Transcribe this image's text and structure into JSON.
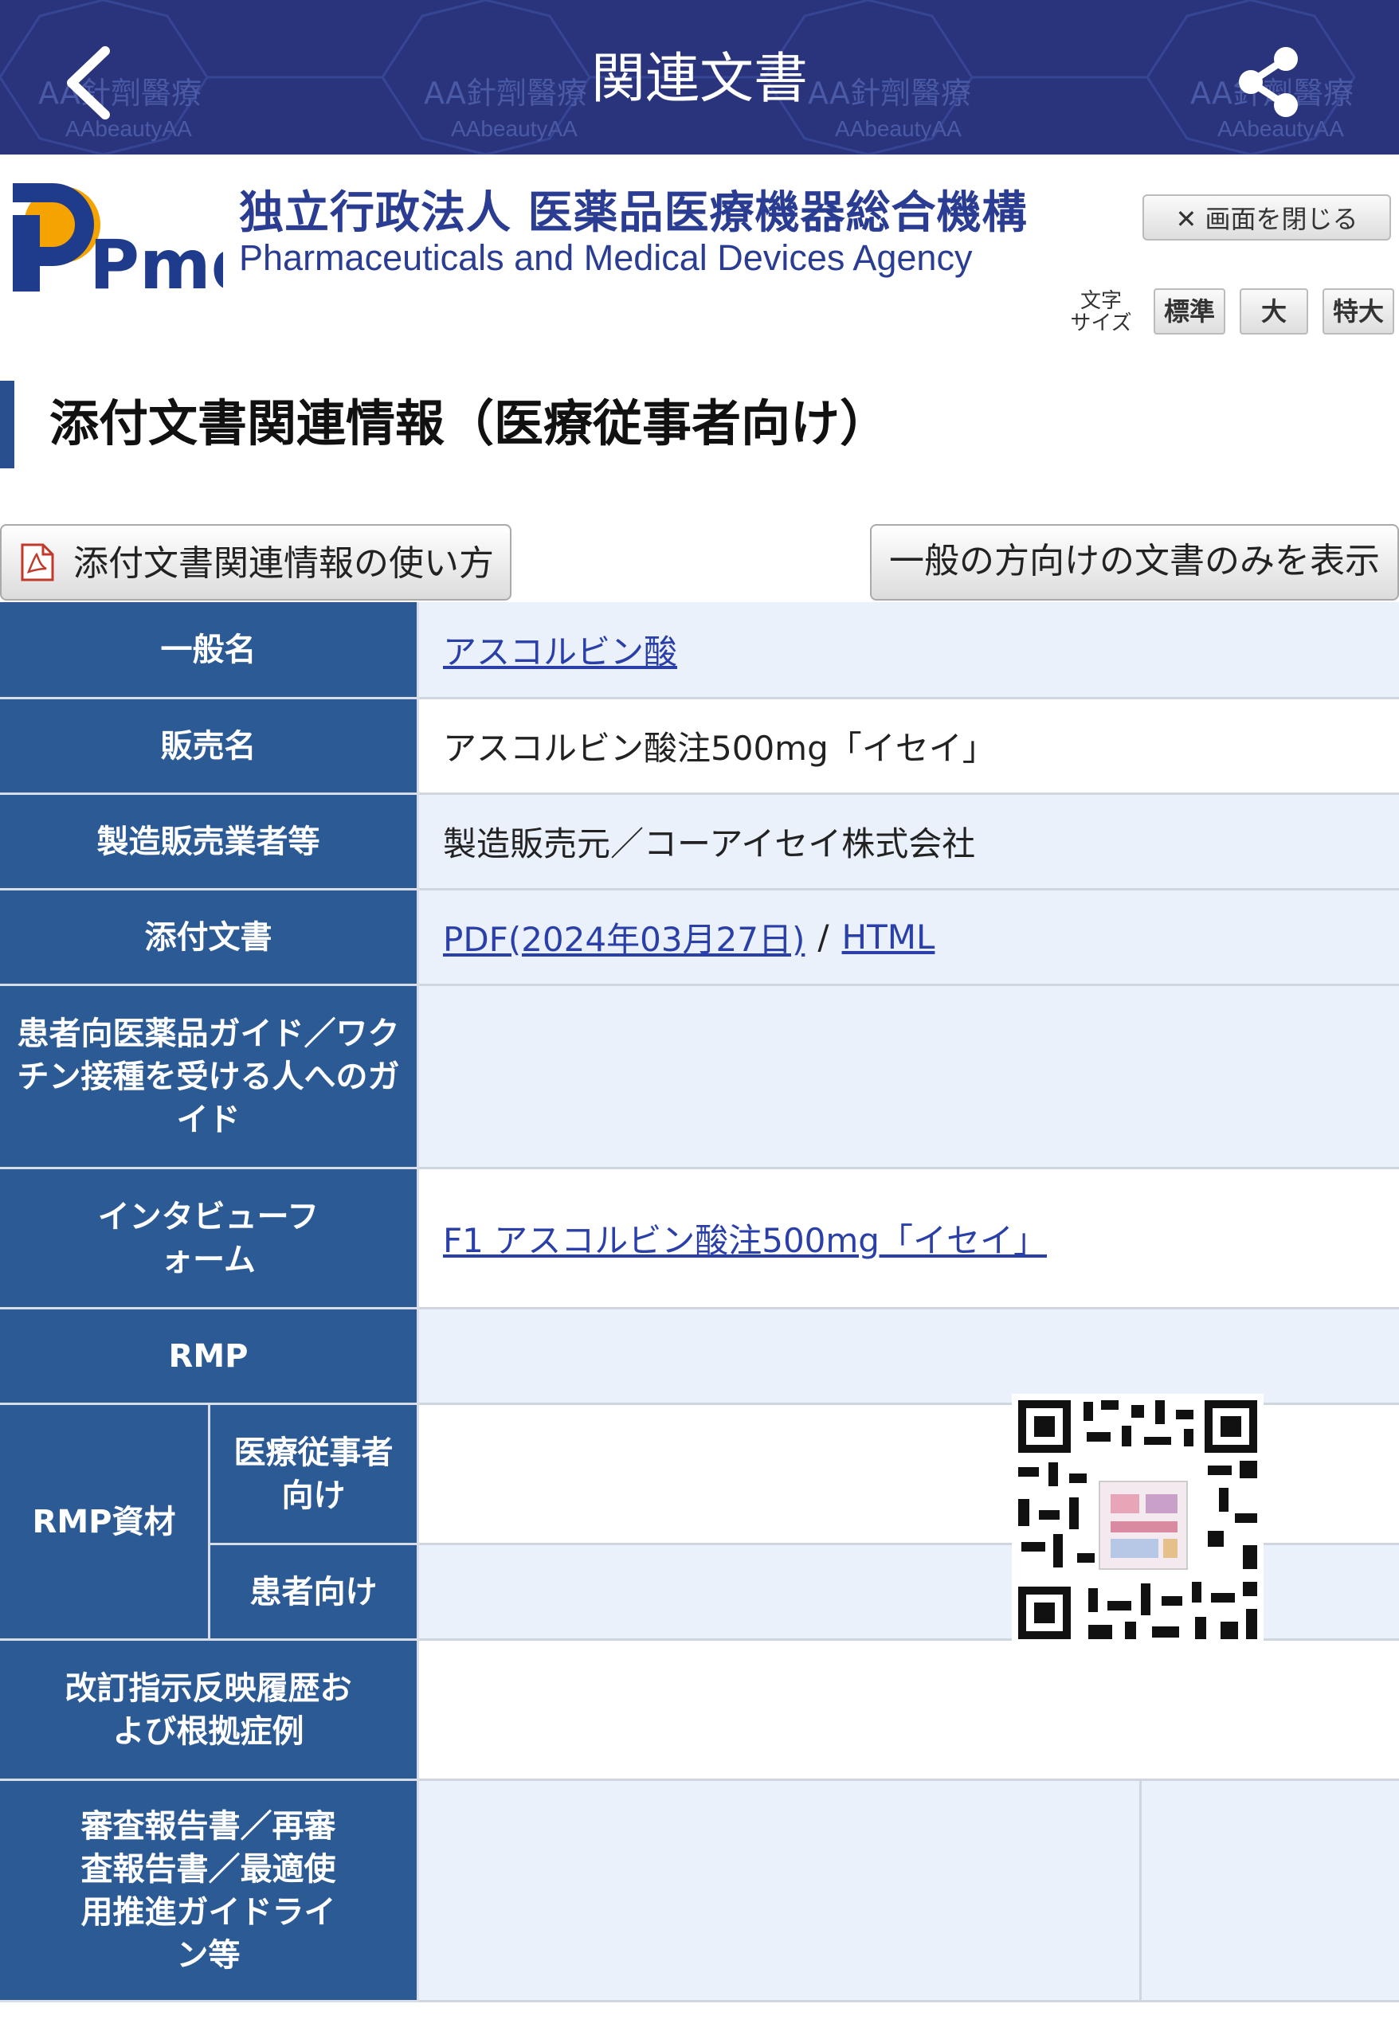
{
  "topbar": {
    "title": "関連文書",
    "watermark_text": "AA針劑醫療",
    "watermark_sub": "AAbeautyAA",
    "back_icon": "chevron-left-icon",
    "share_icon": "share-icon"
  },
  "header": {
    "logo_text": "Pmda",
    "org_name_ja": "独立行政法人 医薬品医療機器総合機構",
    "org_name_en": "Pharmaceuticals and Medical Devices Agency",
    "close_label": "✕ 画面を閉じる",
    "font_size_label_1": "文字",
    "font_size_label_2": "サイズ",
    "font_sizes": [
      "標準",
      "大",
      "特大"
    ]
  },
  "page": {
    "section_title": "添付文書関連情報（医療従事者向け）",
    "howto_label": "添付文書関連情報の使い方",
    "general_only_label": "一般の方向けの文書のみを表示"
  },
  "table": {
    "generic_name_h": "一般名",
    "generic_name_v": "アスコルビン酸",
    "brand_name_h": "販売名",
    "brand_name_v": "アスコルビン酸注500mg「イセイ」",
    "maker_h": "製造販売業者等",
    "maker_v": "製造販売元／コーアイセイ株式会社",
    "package_insert_h": "添付文書",
    "package_insert_pdf": "PDF(2024年03月27日)",
    "package_insert_sep": "/",
    "package_insert_html": "HTML",
    "patient_guide_h": "患者向医薬品ガイド／ワクチン接種を受ける人へのガイド",
    "interview_h": "インタビューフォーム",
    "interview_v": "F1 アスコルビン酸注500mg「イセイ」",
    "rmp_h": "RMP",
    "rmp_material_h": "RMP資材",
    "rmp_for_medical_h": "医療従事者向け",
    "rmp_for_patient_h": "患者向け",
    "revision_h": "改訂指示反映履歴および根拠症例",
    "review_h": "審査報告書／再審査報告書／最適使用推進ガイドライン等"
  },
  "colors": {
    "topbar_bg": "#2a347c",
    "header_cell_bg": "#2c5a95",
    "value_cell_bg": "#eaf1fb",
    "link": "#2a3fa8",
    "org_text": "#2a3d92",
    "logo_orange": "#f5a300"
  },
  "icons": {
    "pdf": "pdf-icon",
    "qr": "qr-code"
  }
}
